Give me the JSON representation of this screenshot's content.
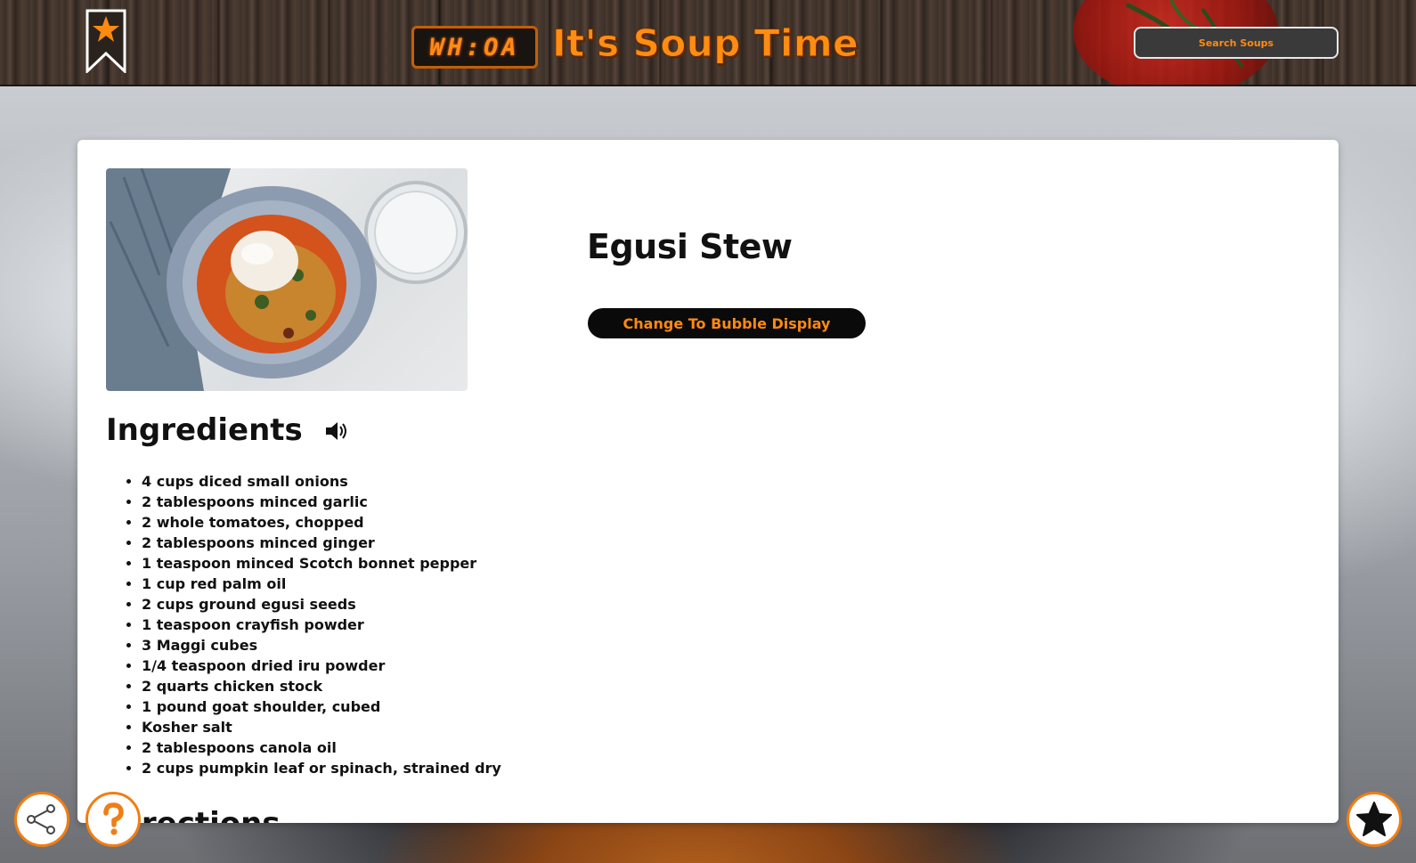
{
  "header": {
    "clock_text": "WH:OA",
    "site_title": "It's Soup Time",
    "search_button_label": "Search Soups",
    "icons": {
      "bookmark": "bookmark-star-icon"
    }
  },
  "recipe": {
    "title": "Egusi Stew",
    "bubble_button_label": "Change To Bubble Display",
    "ingredients_heading": "Ingredients",
    "next_section_heading": "Directions",
    "ingredients": [
      "4 cups diced small onions",
      "2 tablespoons minced garlic",
      "2 whole tomatoes, chopped",
      "2 tablespoons minced ginger",
      "1 teaspoon minced Scotch bonnet pepper",
      "1 cup red palm oil",
      "2 cups ground egusi seeds",
      "1 teaspoon crayfish powder",
      "3 Maggi cubes",
      "1/4 teaspoon dried iru powder",
      "2 quarts chicken stock",
      "1 pound goat shoulder, cubed",
      "Kosher salt",
      "2 tablespoons canola oil",
      "2 cups pumpkin leaf or spinach, strained dry"
    ]
  },
  "floating_buttons": {
    "share_icon": "share-icon",
    "help_icon": "question-icon",
    "favorite_icon": "star-icon"
  },
  "colors": {
    "accent": "#ff8a12",
    "accent_border": "#f07e14",
    "card_bg": "#ffffff",
    "button_dark": "#0a0a0a"
  }
}
